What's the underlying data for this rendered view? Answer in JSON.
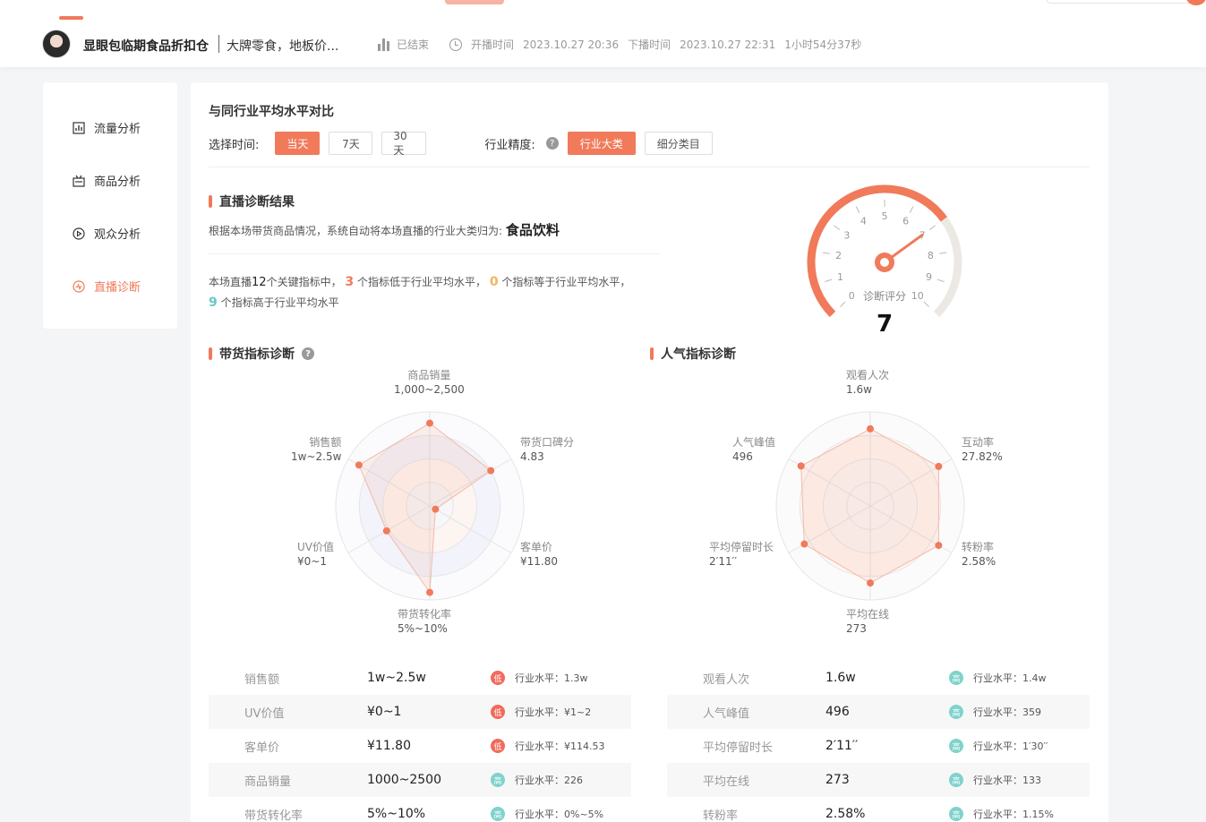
{
  "header": {
    "shop_name": "显眼包临期食品折扣仓",
    "live_title": "大牌零食，地板价...",
    "status": "已结束",
    "start_label": "开播时间",
    "start_time": "2023.10.27 20:36",
    "end_label": "下播时间",
    "end_time": "2023.10.27 22:31",
    "duration": "1小时54分37秒"
  },
  "sidebar": {
    "items": [
      {
        "label": "流量分析",
        "icon": "chart-icon"
      },
      {
        "label": "商品分析",
        "icon": "goods-icon"
      },
      {
        "label": "观众分析",
        "icon": "play-circle-icon"
      },
      {
        "label": "直播诊断",
        "icon": "diagnosis-icon",
        "active": true
      }
    ]
  },
  "comparison": {
    "title": "与同行业平均水平对比",
    "time_label": "选择时间:",
    "time_options": [
      "当天",
      "7天",
      "30天"
    ],
    "selected_time": "当天",
    "precision_label": "行业精度:",
    "precision_options": [
      "行业大类",
      "细分类目"
    ],
    "selected_precision": "行业大类"
  },
  "diagnosis": {
    "title": "直播诊断结果",
    "category_text": "根据本场带货商品情况，系统自动将本场直播的行业大类归为:",
    "category": "食品饮料",
    "summary_prefix": "本场直播",
    "total": "12",
    "summary_a": "个关键指标中，",
    "low": "3",
    "summary_b": "个指标低于行业平均水平，",
    "equal": "0",
    "summary_c": "个指标等于行业平均水平，",
    "high": "9",
    "summary_d": "个指标高于行业平均水平"
  },
  "gauge": {
    "label": "诊断评分",
    "score": "7",
    "score_value": 7,
    "min": 0,
    "max": 10,
    "ticks": [
      "0",
      "1",
      "2",
      "3",
      "4",
      "5",
      "6",
      "7",
      "8",
      "9",
      "10"
    ],
    "color": "#f07a5a"
  },
  "sales_radar": {
    "title": "带货指标诊断",
    "axes": [
      {
        "name": "商品销量",
        "value": "1,000~2,500",
        "score": 0.88
      },
      {
        "name": "带货口碑分",
        "value": "4.83",
        "score": 0.75
      },
      {
        "name": "客单价",
        "value": "¥11.80",
        "score": 0.07
      },
      {
        "name": "带货转化率",
        "value": "5%~10%",
        "score": 0.92
      },
      {
        "name": "UV价值",
        "value": "¥0~1",
        "score": 0.53
      },
      {
        "name": "销售额",
        "value": "1w~2.5w",
        "score": 0.87
      }
    ]
  },
  "popularity_radar": {
    "title": "人气指标诊断",
    "axes": [
      {
        "name": "观看人次",
        "value": "1.6w",
        "score": 0.82
      },
      {
        "name": "互动率",
        "value": "27.82%",
        "score": 0.84
      },
      {
        "name": "转粉率",
        "value": "2.58%",
        "score": 0.84
      },
      {
        "name": "平均在线",
        "value": "273",
        "score": 0.82
      },
      {
        "name": "平均停留时长",
        "value": "2′11′′",
        "score": 0.81
      },
      {
        "name": "人气峰值",
        "value": "496",
        "score": 0.85
      }
    ]
  },
  "sales_table": [
    {
      "name": "销售额",
      "value": "1w~2.5w",
      "level": "低",
      "industry": "行业水平：1.3w"
    },
    {
      "name": "UV价值",
      "value": "¥0~1",
      "level": "低",
      "industry": "行业水平：¥1~2"
    },
    {
      "name": "客单价",
      "value": "¥11.80",
      "level": "低",
      "industry": "行业水平：¥114.53"
    },
    {
      "name": "商品销量",
      "value": "1000~2500",
      "level": "高",
      "industry": "行业水平：226"
    },
    {
      "name": "带货转化率",
      "value": "5%~10%",
      "level": "高",
      "industry": "行业水平：0%~5%"
    }
  ],
  "popularity_table": [
    {
      "name": "观看人次",
      "value": "1.6w",
      "level": "高",
      "industry": "行业水平：1.4w"
    },
    {
      "name": "人气峰值",
      "value": "496",
      "level": "高",
      "industry": "行业水平：359"
    },
    {
      "name": "平均停留时长",
      "value": "2′11′′",
      "level": "高",
      "industry": "行业水平：1′30′′"
    },
    {
      "name": "平均在线",
      "value": "273",
      "level": "高",
      "industry": "行业水平：133"
    },
    {
      "name": "转粉率",
      "value": "2.58%",
      "level": "高",
      "industry": "行业水平：1.15%"
    }
  ],
  "colors": {
    "accent": "#f07a5a",
    "low": "#f26a5c",
    "high": "#7fd3cc",
    "equal": "#f2b55a"
  }
}
